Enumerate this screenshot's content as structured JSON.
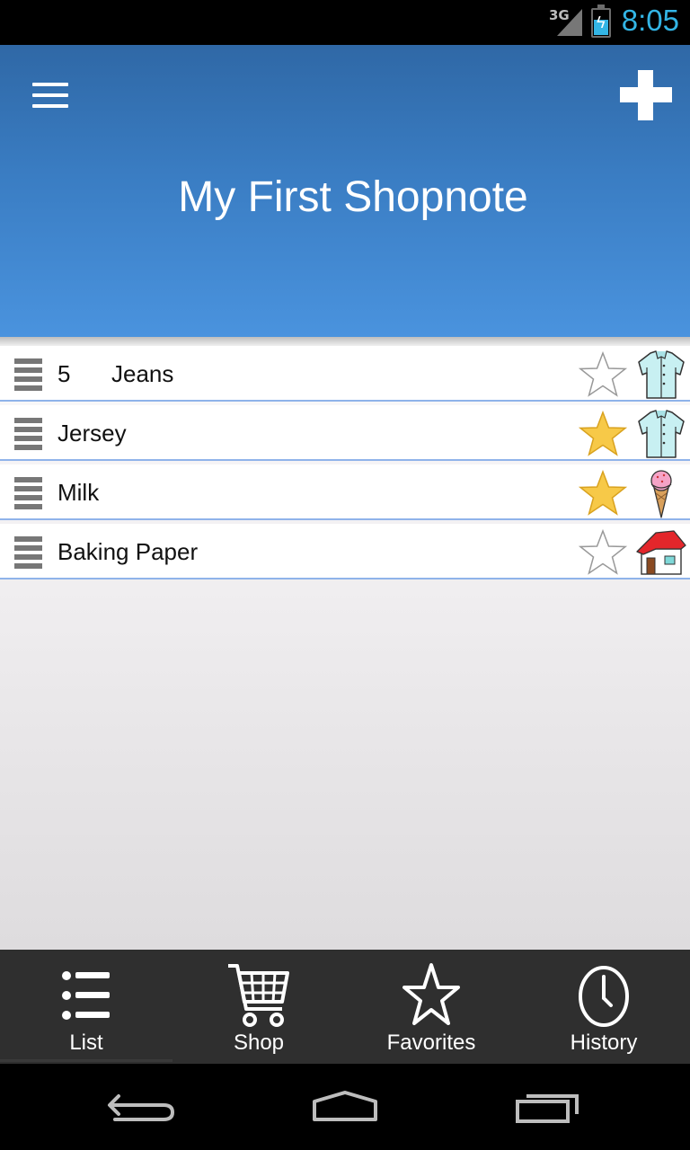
{
  "status_bar": {
    "network": "3G",
    "time": "8:05",
    "accent_color": "#33b5e5"
  },
  "header": {
    "title": "My First Shopnote",
    "menu_icon": "hamburger-menu-icon",
    "add_icon": "plus-icon"
  },
  "items": [
    {
      "qty": "5",
      "name": "Jeans",
      "favorite": false,
      "category_icon": "shirt-icon"
    },
    {
      "qty": "",
      "name": "Jersey",
      "favorite": true,
      "category_icon": "shirt-icon"
    },
    {
      "qty": "",
      "name": "Milk",
      "favorite": true,
      "category_icon": "ice-cream-icon"
    },
    {
      "qty": "",
      "name": "Baking Paper",
      "favorite": false,
      "category_icon": "house-icon"
    }
  ],
  "tabs": [
    {
      "label": "List",
      "icon": "list-icon",
      "active": true
    },
    {
      "label": "Shop",
      "icon": "shopping-cart-icon",
      "active": false
    },
    {
      "label": "Favorites",
      "icon": "star-icon",
      "active": false
    },
    {
      "label": "History",
      "icon": "clock-icon",
      "active": false
    }
  ],
  "nav": {
    "back_icon": "back-icon",
    "home_icon": "home-icon",
    "recents_icon": "recent-apps-icon"
  },
  "colors": {
    "header_top": "#2f68a6",
    "header_bottom": "#4a93de",
    "row_separator": "#8fb3ea",
    "star_filled": "#f7c948"
  }
}
